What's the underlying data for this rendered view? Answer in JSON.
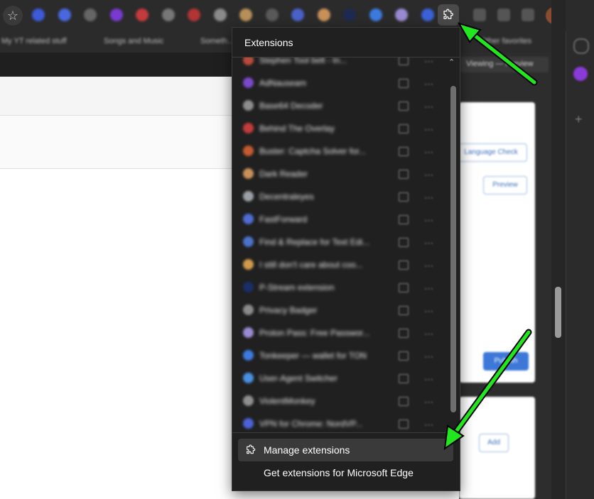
{
  "extensions_panel": {
    "title": "Extensions",
    "footer": {
      "manage_label": "Manage extensions",
      "get_label": "Get extensions for Microsoft Edge"
    },
    "items": [
      {
        "name": "Stephen Tool belt - In...",
        "color": "#b94a3a"
      },
      {
        "name": "AdNauseam",
        "color": "#7a49c9"
      },
      {
        "name": "Base64 Decoder",
        "color": "#8d8d8d"
      },
      {
        "name": "Behind The Overlay",
        "color": "#c43b3b"
      },
      {
        "name": "Buster: Captcha Solver for...",
        "color": "#c45a2f"
      },
      {
        "name": "Dark Reader",
        "color": "#c9915a"
      },
      {
        "name": "Decentraleyes",
        "color": "#9aa0a6"
      },
      {
        "name": "FastForward",
        "color": "#4e6cd1"
      },
      {
        "name": "Find & Replace for Text Edi...",
        "color": "#4c72c9"
      },
      {
        "name": "I still don't care about coo...",
        "color": "#d19a4a"
      },
      {
        "name": "P-Stream extension",
        "color": "#1b2e66"
      },
      {
        "name": "Privacy Badger",
        "color": "#8a8a8a"
      },
      {
        "name": "Proton Pass: Free Passwor...",
        "color": "#9a8ad1"
      },
      {
        "name": "Tonkeeper — wallet for TON",
        "color": "#3d7be0"
      },
      {
        "name": "User-Agent Switcher",
        "color": "#4a8fe0"
      },
      {
        "name": "ViolentMonkey",
        "color": "#8f8f8f"
      },
      {
        "name": "VPN for Chrome: NordVP...",
        "color": "#4b62d9"
      }
    ]
  },
  "bookmarks": [
    {
      "label": "My YT related stuff"
    },
    {
      "label": "Songs and Music"
    },
    {
      "label": "Someth..."
    },
    {
      "label": "Other favorites"
    }
  ],
  "side_panel": {
    "buttons": [
      "Language Check",
      "Preview",
      "Publish",
      "Add"
    ],
    "dropdown": "Viewing — Preview"
  },
  "toolbar_icons": [
    {
      "name": "toolbar-ext-1",
      "color": "#3d5ad9"
    },
    {
      "name": "toolbar-ext-2",
      "color": "#4a67e0"
    },
    {
      "name": "toolbar-ext-3",
      "color": "#666666"
    },
    {
      "name": "toolbar-ext-4",
      "color": "#7a3ad1"
    },
    {
      "name": "toolbar-ext-5",
      "color": "#c43b3b"
    },
    {
      "name": "toolbar-ext-6",
      "color": "#777777"
    },
    {
      "name": "toolbar-ext-7",
      "color": "#b23434"
    },
    {
      "name": "toolbar-ext-8",
      "color": "#8a8a8a"
    },
    {
      "name": "toolbar-ext-9",
      "color": "#b8905a"
    },
    {
      "name": "toolbar-ext-10",
      "color": "#5a5a5a"
    },
    {
      "name": "toolbar-ext-11",
      "color": "#4a62c9"
    },
    {
      "name": "toolbar-ext-12",
      "color": "#c9915a"
    },
    {
      "name": "toolbar-ext-13",
      "color": "#1e2a52"
    },
    {
      "name": "toolbar-ext-14",
      "color": "#3d7be0"
    },
    {
      "name": "toolbar-ext-15",
      "color": "#9a8ad1"
    },
    {
      "name": "toolbar-ext-16",
      "color": "#3b62d9"
    }
  ],
  "colors": {
    "arrow": "#22e61e",
    "panel_bg": "#202020",
    "toolbar_bg": "#2b2b2b"
  }
}
